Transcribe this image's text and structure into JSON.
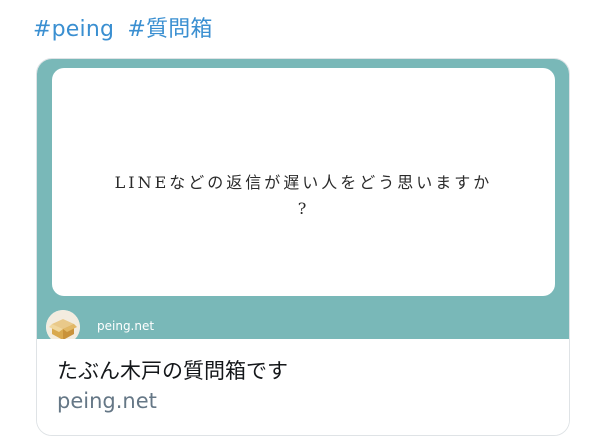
{
  "hashtags": [
    "#peing",
    "#質問箱"
  ],
  "card": {
    "question_line1": "LINEなどの返信が遅い人をどう思いますか",
    "question_line2": "?",
    "image_site_label": "peing.net",
    "title": "たぶん木戸の質問箱です",
    "domain": "peing.net"
  },
  "colors": {
    "hashtag": "#3a8fd1",
    "card_teal": "#79b8b8",
    "domain_gray": "#657786"
  },
  "icons": {
    "avatar": "box-logo-icon"
  }
}
